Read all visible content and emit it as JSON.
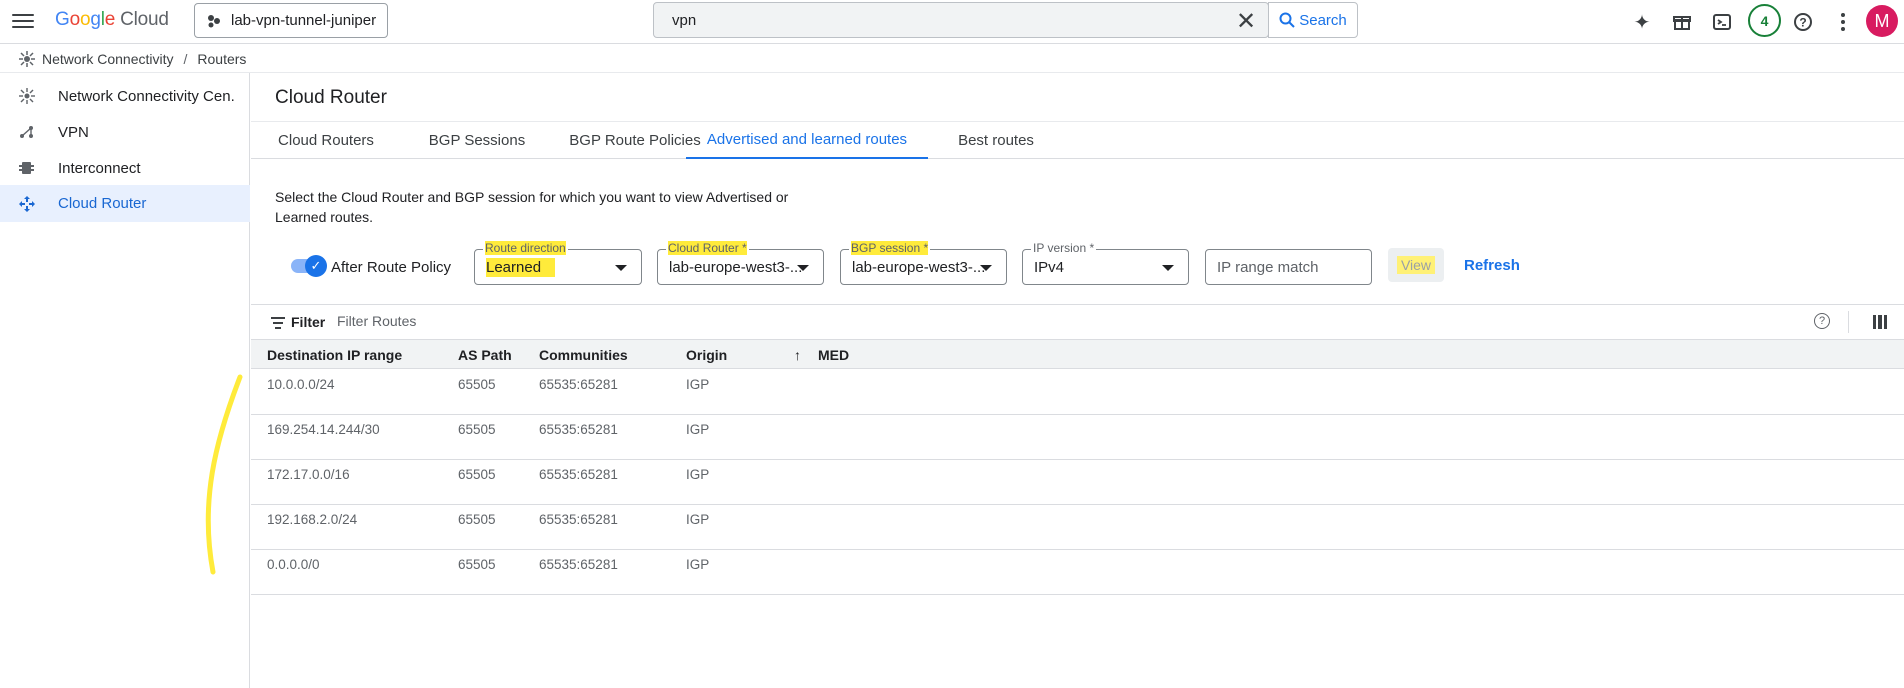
{
  "topbar": {
    "logo_google": "Google",
    "logo_cloud": "Cloud",
    "project": "lab-vpn-tunnel-juniper",
    "search_value": "vpn",
    "search_button": "Search",
    "notifications_count": "4",
    "avatar_initial": "M"
  },
  "breadcrumb": {
    "section": "Network Connectivity",
    "page": "Routers"
  },
  "sidebar": {
    "items": [
      {
        "label": "Network Connectivity Cen...",
        "icon": "hub-icon"
      },
      {
        "label": "VPN",
        "icon": "vpn-icon"
      },
      {
        "label": "Interconnect",
        "icon": "interconnect-icon"
      },
      {
        "label": "Cloud Router",
        "icon": "router-icon",
        "active": true
      }
    ]
  },
  "main": {
    "title": "Cloud Router",
    "tabs": [
      {
        "label": "Cloud Routers"
      },
      {
        "label": "BGP Sessions"
      },
      {
        "label": "BGP Route Policies"
      },
      {
        "label": "Advertised and learned routes",
        "active": true
      },
      {
        "label": "Best routes"
      }
    ],
    "description": "Select the Cloud Router and BGP session for which you want to view Advertised or Learned routes.",
    "toggle_label": "After Route Policy",
    "toggle_on": true,
    "fields": {
      "route_direction": {
        "label": "Route direction",
        "value": "Learned"
      },
      "cloud_router": {
        "label": "Cloud Router *",
        "value": "lab-europe-west3-..."
      },
      "bgp_session": {
        "label": "BGP session *",
        "value": "lab-europe-west3-..."
      },
      "ip_version": {
        "label": "IP version *",
        "value": "IPv4"
      },
      "ip_range": {
        "placeholder": "IP range match"
      }
    },
    "view_button": "View",
    "refresh_button": "Refresh"
  },
  "table": {
    "filter_label": "Filter",
    "filter_placeholder": "Filter Routes",
    "headers": [
      "Destination IP range",
      "AS Path",
      "Communities",
      "Origin",
      "MED"
    ],
    "sort_arrow": "↑",
    "rows": [
      [
        "10.0.0.0/24",
        "65505",
        "65535:65281",
        "IGP"
      ],
      [
        "169.254.14.244/30",
        "65505",
        "65535:65281",
        "IGP"
      ],
      [
        "172.17.0.0/16",
        "65505",
        "65535:65281",
        "IGP"
      ],
      [
        "192.168.2.0/24",
        "65505",
        "65535:65281",
        "IGP"
      ],
      [
        "0.0.0.0/0",
        "65505",
        "65535:65281",
        "IGP"
      ]
    ]
  },
  "colors": {
    "accent": "#1a73e8",
    "highlight": "#ffeb3b",
    "active_bg": "#e8f0fe"
  }
}
